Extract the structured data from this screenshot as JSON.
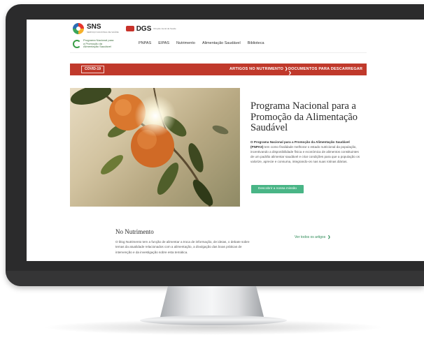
{
  "header": {
    "sns_logo": {
      "title": "SNS",
      "subtitle": "SERVIÇO NACIONAL DE SAÚDE"
    },
    "dgs_logo": {
      "title": "DGS",
      "subtitle": "Direção-Geral da Saúde"
    },
    "program_logo": "Programa Nacional para a Promoção da Alimentação Saudável",
    "nav": [
      "PNPAS",
      "EIPAS",
      "Nutrimento",
      "Alimentação Saudável",
      "Biblioteca"
    ]
  },
  "redbar": {
    "badge": "COVID-19",
    "links": [
      "ARTIGOS NO NUTRIMENTO",
      "DOCUMENTOS PARA DESCARREGAR"
    ]
  },
  "hero": {
    "title": "Programa Nacional para a Promoção da Alimentação Saudável",
    "description_bold": "O Programa Nacional para a Promoção da Alimentação Saudável (PNPAS)",
    "description": " tem como finalidade melhorar o estado nutricional da população, incentivando a disponibilidade física e económica de alimentos constituintes de um padrão alimentar saudável e criar condições para que a população os valorize, aprecie e consuma, integrando-os nas suas rotinas diárias.",
    "cta": "Descobrir a nossa missão"
  },
  "news": {
    "title": "No Nutrimento",
    "text": "O blog Nutrimento tem a função de alimentar a troca de informação, de ideias, o debate sobre temas da atualidade relacionados com a alimentação, a divulgação das boas práticas de intervenção e da investigação sobre esta temática.",
    "link": "Ver todos os artigos"
  },
  "colors": {
    "red_bar": "#c0392b",
    "cta_green": "#49b586",
    "monitor": "#2b2b2c"
  },
  "icons": [
    "sns-logo-icon",
    "dgs-logo-icon",
    "leaf-logo-icon",
    "chevron-right-icon",
    "orange-tree-photo"
  ]
}
